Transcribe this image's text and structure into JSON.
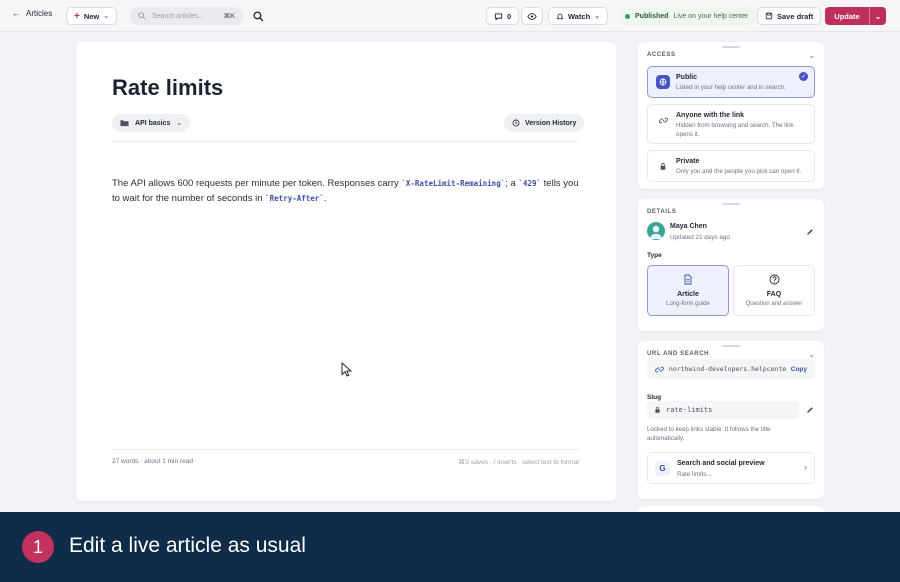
{
  "topbar": {
    "back_label": "Articles",
    "new_label": "New",
    "search_placeholder": "Search articles...",
    "search_shortcut": "⌘K",
    "comment_count": "0",
    "watch_label": "Watch",
    "status_label": "Published",
    "status_detail": "Live on your help center",
    "save_draft_label": "Save draft",
    "update_label": "Update"
  },
  "editor": {
    "title": "Rate limits",
    "collection": "API basics",
    "version_history_label": "Version History",
    "body": {
      "t1": "The API allows 600 requests per minute per token. Responses carry ",
      "c1": "`X-RateLimit-Remaining`",
      "t2": "; a ",
      "c2": "`429`",
      "t3": " tells you to wait for the number of seconds in ",
      "c3": "`Retry-After`",
      "t4": "."
    },
    "footer_left": "27 words · about 1 min read",
    "footer_right": "⌘S saves · / inserts · select text to format"
  },
  "access": {
    "title": "ACCESS",
    "options": [
      {
        "label": "Public",
        "desc": "Listed in your help center and in search."
      },
      {
        "label": "Anyone with the link",
        "desc": "Hidden from browsing and search. The link opens it."
      },
      {
        "label": "Private",
        "desc": "Only you and the people you pick can open it."
      }
    ]
  },
  "details": {
    "title": "DETAILS",
    "author": "Maya Chen",
    "updated": "Updated 21 days ago",
    "type_label": "Type",
    "types": [
      {
        "label": "Article",
        "desc": "Long-form guide"
      },
      {
        "label": "FAQ",
        "desc": "Question and answer"
      }
    ]
  },
  "url": {
    "title": "URL AND SEARCH",
    "url": "northwind-developers.helpcenter.io/articles/rate-limits",
    "copy_label": "Copy",
    "slug_label": "Slug",
    "slug": "rate-limits",
    "slug_note": "Locked to keep links stable. It follows the title automatically.",
    "seo_title": "Search and social preview",
    "seo_desc": "Rate limits..."
  },
  "banner": {
    "step": "1",
    "text": "Edit a live article as usual"
  },
  "colors": {
    "accent": "#be2f5a",
    "selected": "#4553c5",
    "banner_bg": "#0f2c49",
    "published": "#2fa24a"
  }
}
